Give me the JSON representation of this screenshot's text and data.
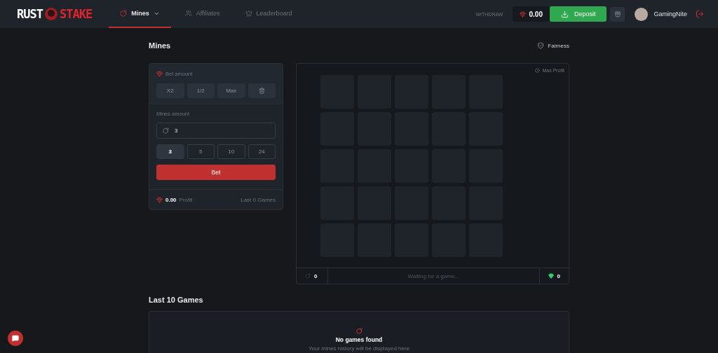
{
  "header": {
    "logo": {
      "left": "RUST",
      "right": "STAKE"
    },
    "nav": [
      {
        "label": "Mines",
        "selected": true,
        "dropdown": true
      },
      {
        "label": "Affiliates",
        "selected": false,
        "dropdown": false
      },
      {
        "label": "Leaderboard",
        "selected": false,
        "dropdown": false
      }
    ],
    "withdraw": "WITHDRAW",
    "balance": "0.00",
    "deposit": "Deposit",
    "username": "GamingNite"
  },
  "title": "Mines",
  "fairness": "Fairness",
  "controls": {
    "bet_label": "Bet amount",
    "bet_buttons": [
      "X2",
      "1/2",
      "Max"
    ],
    "mines_label": "Mines amount",
    "mines_value": "3",
    "mine_options": [
      {
        "label": "3",
        "selected": true
      },
      {
        "label": "5",
        "selected": false
      },
      {
        "label": "10",
        "selected": false
      },
      {
        "label": "24",
        "selected": false
      }
    ],
    "bet": "Bet",
    "profit_value": "0.00",
    "profit_label": "Profit",
    "last_games": "Last 0 Games"
  },
  "board": {
    "max_profit": "Max Profit",
    "mines_count": "0",
    "status": "Waiting for a game...",
    "gems_count": "0"
  },
  "history": {
    "title": "Last 10 Games",
    "empty_title": "No games found",
    "empty_text": "Your mines history will be displayed here"
  }
}
